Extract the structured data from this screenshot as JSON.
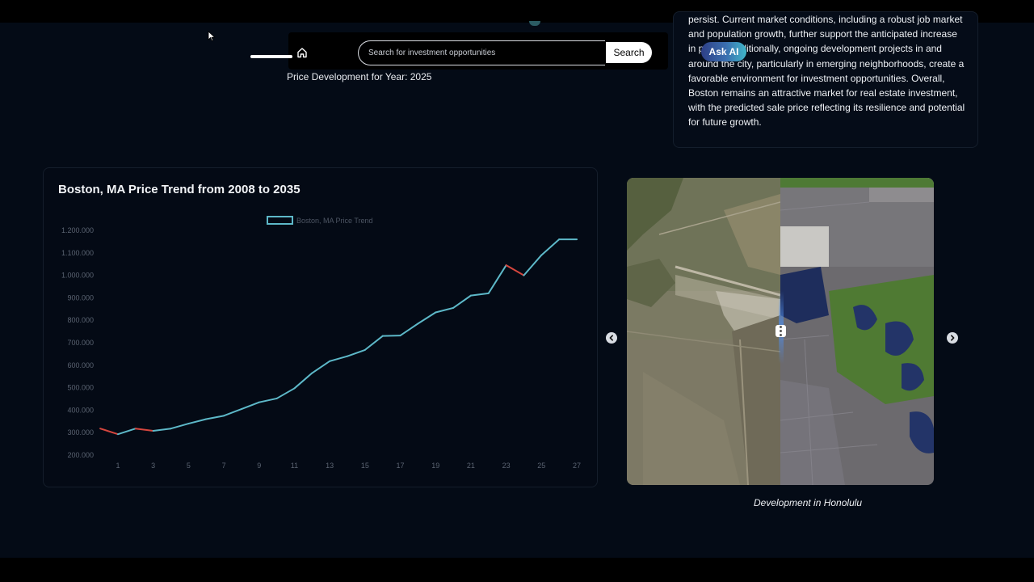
{
  "nav": {
    "search_placeholder": "Search for investment opportunities",
    "search_button": "Search",
    "ask_ai_button": "Ask AI"
  },
  "price_development_label": "Price Development for Year: 2025",
  "analysis_text": "persist. Current market conditions, including a robust job market and population growth, further support the anticipated increase in prices. Additionally, ongoing development projects in and around the city, particularly in emerging neighborhoods, create a favorable environment for investment opportunities. Overall, Boston remains an attractive market for real estate investment, with the predicted sale price reflecting its resilience and potential for future growth.",
  "chart_data": {
    "type": "line",
    "title": "Boston, MA Price Trend from 2008 to 2035",
    "legend": [
      "Boston, MA Price Trend"
    ],
    "legend_position": "top-center",
    "y_ticks": [
      "1.200.000",
      "1.100.000",
      "1.000.000",
      "900.000",
      "800.000",
      "700.000",
      "600.000",
      "500.000",
      "400.000",
      "300.000",
      "200.000"
    ],
    "x_ticks": [
      "1",
      "3",
      "5",
      "7",
      "9",
      "11",
      "13",
      "15",
      "17",
      "19",
      "21",
      "23",
      "25",
      "27"
    ],
    "ylim": [
      200000,
      1200000
    ],
    "xlim": [
      1,
      27
    ],
    "grid": false,
    "colors": {
      "up": "#5db8c8",
      "down": "#d6463e"
    },
    "series": [
      {
        "name": "Boston, MA Price Trend",
        "x": [
          0,
          1,
          2,
          3,
          4,
          5,
          6,
          7,
          8,
          9,
          10,
          11,
          12,
          13,
          14,
          15,
          16,
          17,
          18,
          19,
          20,
          21,
          22,
          23,
          24,
          25,
          26,
          27
        ],
        "values": [
          318000,
          293000,
          318000,
          308000,
          318000,
          340000,
          360000,
          375000,
          405000,
          435000,
          452000,
          497000,
          565000,
          618000,
          640000,
          668000,
          730000,
          732000,
          785000,
          835000,
          855000,
          910000,
          920000,
          1045000,
          1000000,
          1090000,
          1160000,
          1160000
        ]
      }
    ]
  },
  "carousel": {
    "caption": "Development in Honolulu"
  }
}
